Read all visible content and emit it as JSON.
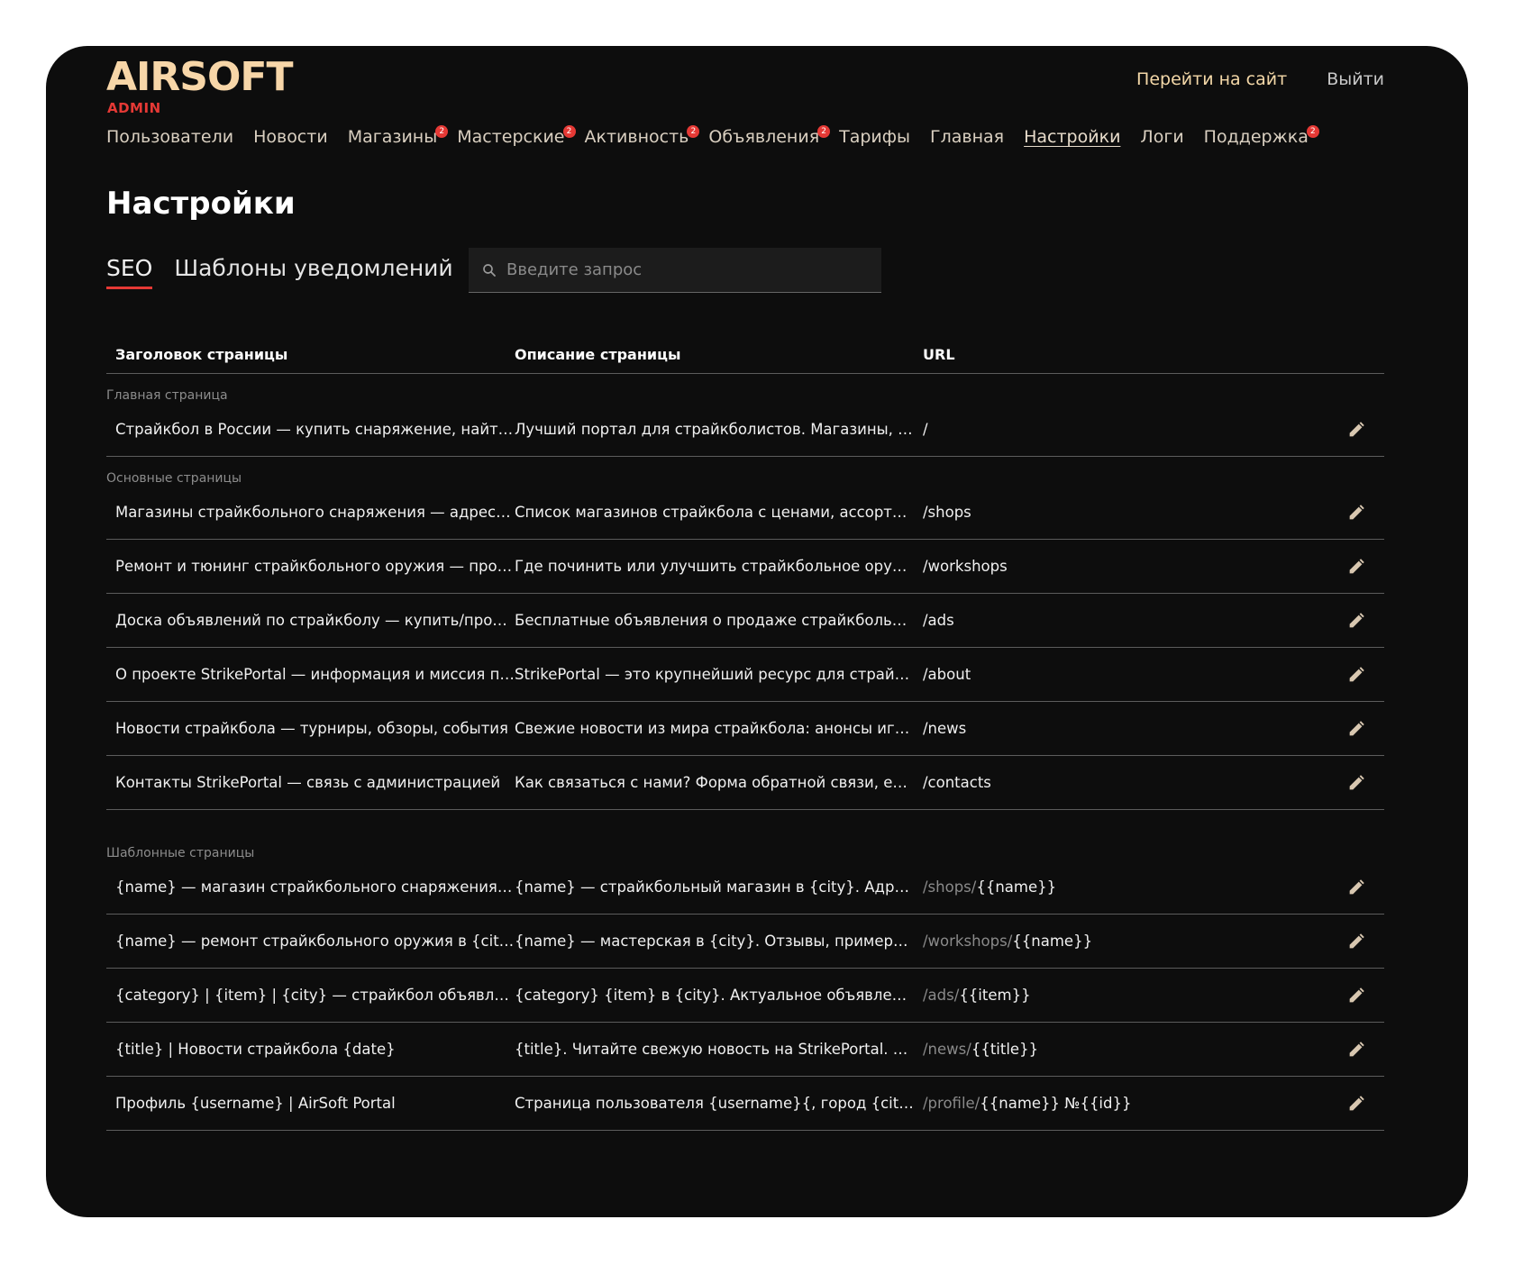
{
  "brand": {
    "logo_text": "AIRSOFT",
    "logo_sub": "ADMIN",
    "logo_color": "#f7d6a8",
    "accent": "#e53935"
  },
  "header": {
    "go_to_site": "Перейти на сайт",
    "logout": "Выйти"
  },
  "nav": [
    {
      "label": "Пользователи",
      "badge": ""
    },
    {
      "label": "Новости",
      "badge": ""
    },
    {
      "label": "Магазины",
      "badge": "2"
    },
    {
      "label": "Мастерские",
      "badge": "2"
    },
    {
      "label": "Активность",
      "badge": "2"
    },
    {
      "label": "Объявления",
      "badge": "2"
    },
    {
      "label": "Тарифы",
      "badge": ""
    },
    {
      "label": "Главная",
      "badge": ""
    },
    {
      "label": "Настройки",
      "badge": "",
      "active": true
    },
    {
      "label": "Логи",
      "badge": ""
    },
    {
      "label": "Поддержка",
      "badge": "2"
    }
  ],
  "page": {
    "title": "Настройки"
  },
  "tabs": [
    {
      "label": "SEO",
      "active": true
    },
    {
      "label": "Шаблоны уведомлений",
      "active": false
    }
  ],
  "search": {
    "placeholder": "Введите запрос",
    "value": ""
  },
  "table": {
    "headers": {
      "title": "Заголовок страницы",
      "description": "Описание страницы",
      "url": "URL"
    },
    "groups": [
      {
        "label": "Главная страница",
        "rows": [
          {
            "title": "Страйкбол в России — купить снаряжение, найти команду, записаться на игру",
            "description": "Лучший портал для страйкболистов. Магазины, мастерские, объявления",
            "url_prefix": "",
            "url": "/"
          }
        ]
      },
      {
        "label": "Основные страницы",
        "rows": [
          {
            "title": "Магазины страйкбольного снаряжения — адреса, контакты",
            "description": "Список магазинов страйкбола с ценами, ассортиментом и отзывами",
            "url_prefix": "",
            "url": "/shops"
          },
          {
            "title": "Ремонт и тюнинг страйкбольного оружия — проверенные мастерские",
            "description": "Где починить или улучшить страйкбольное оружие? Мастерские",
            "url_prefix": "",
            "url": "/workshops"
          },
          {
            "title": "Доска объявлений по страйкболу — купить/продать снаряжение",
            "description": "Бесплатные объявления о продаже страйкбольного снаряжения",
            "url_prefix": "",
            "url": "/ads"
          },
          {
            "title": "О проекте StrikePortal — информация и миссия портала",
            "description": "StrikePortal — это крупнейший ресурс для страйкболистов",
            "url_prefix": "",
            "url": "/about"
          },
          {
            "title": "Новости страйкбола — турниры, обзоры, события",
            "description": "Свежие новости из мира страйкбола: анонсы игр, обзоры",
            "url_prefix": "",
            "url": "/news"
          },
          {
            "title": "Контакты StrikePortal — связь с администрацией",
            "description": "Как связаться с нами? Форма обратной связи, email, телефон",
            "url_prefix": "",
            "url": "/contacts"
          }
        ]
      },
      {
        "label": "Шаблонные страницы",
        "rows": [
          {
            "title": "{name} — магазин страйкбольного снаряжения в {city}",
            "description": "{name} — страйкбольный магазин в {city}. Адрес, контакты",
            "url_prefix": "/shops/",
            "url": "{{name}}"
          },
          {
            "title": "{name} — ремонт страйкбольного оружия в {city}",
            "description": "{name} — мастерская в {city}. Отзывы, примеры работ",
            "url_prefix": "/workshops/",
            "url": "{{name}}"
          },
          {
            "title": "{category} | {item} | {city} — страйкбол объявления",
            "description": "{category} {item} в {city}. Актуальное объявление на портале",
            "url_prefix": "/ads/",
            "url": "{{item}}"
          },
          {
            "title": "{title} | Новости страйкбола {date}",
            "description": "{title}. Читайте свежую новость на StrikePortal. Анонсы",
            "url_prefix": "/news/",
            "url": "{{title}}"
          },
          {
            "title": "Профиль {username} | AirSoft Portal",
            "description": "Страница пользователя {username}{, город {city}}. Контакты",
            "url_prefix": "/profile/",
            "url": "{{name}} №{{id}}"
          }
        ]
      }
    ]
  }
}
